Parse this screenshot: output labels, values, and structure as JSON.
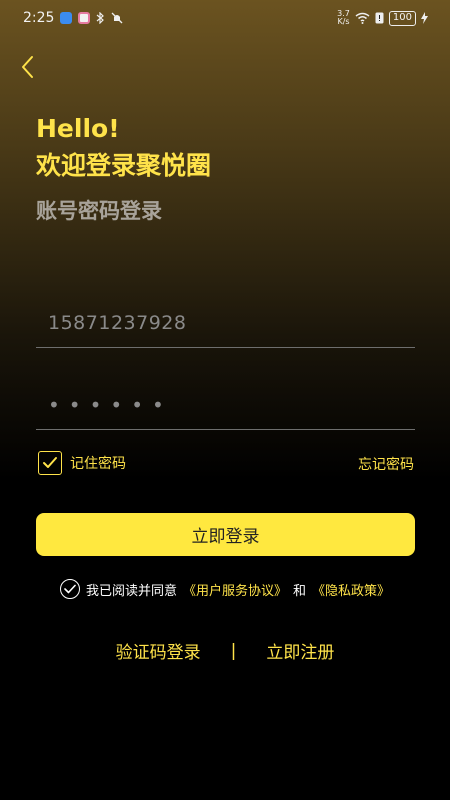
{
  "status_bar": {
    "time": "2:25",
    "net_speed": "3.7\nK/s",
    "battery": "100"
  },
  "header": {
    "greeting": "Hello!",
    "welcome": "欢迎登录聚悦圈",
    "subtitle": "账号密码登录"
  },
  "form": {
    "phone_value": "15871237928",
    "password_dots": "••••••",
    "remember_label": "记住密码",
    "remember_checked": true,
    "forgot_label": "忘记密码",
    "login_label": "立即登录"
  },
  "agreement": {
    "prefix": "我已阅读并同意",
    "user_agreement": "《用户服务协议》",
    "and": "和",
    "privacy_policy": "《隐私政策》",
    "checked": true
  },
  "footer": {
    "sms_login": "验证码登录",
    "divider": "|",
    "register": "立即注册"
  },
  "colors": {
    "accent": "#ffe34a",
    "button_bg": "#ffe83f",
    "background_top": "#6b5320",
    "background_bottom": "#000000"
  }
}
